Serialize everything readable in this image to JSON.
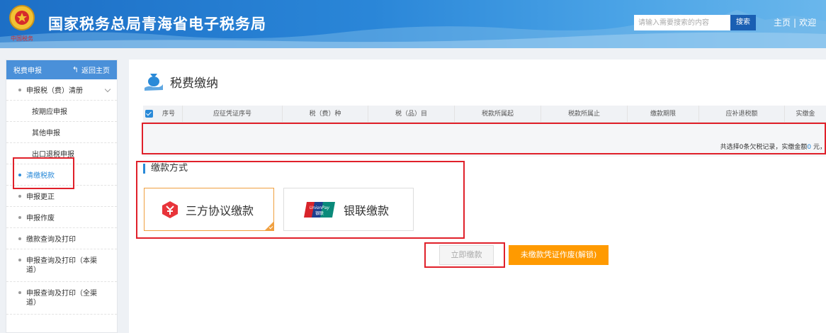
{
  "header": {
    "title": "国家税务总局青海省电子税务局",
    "search_placeholder": "请输入需要搜索的内容",
    "search_button": "搜索",
    "home_link": "主页",
    "separator": "|",
    "welcome": "欢迎",
    "emblem_icon": "national-tax-emblem-icon",
    "emblem_caption": "中国税务"
  },
  "sidebar": {
    "header_title": "税费申报",
    "back_label": "返回主页",
    "back_icon": "back-arrow-icon",
    "items": [
      {
        "label": "申报税（费）清册",
        "type": "group",
        "expandable": true
      },
      {
        "label": "按期应申报",
        "type": "sub"
      },
      {
        "label": "其他申报",
        "type": "sub"
      },
      {
        "label": "出口退税申报",
        "type": "sub"
      },
      {
        "label": "清缴税款",
        "type": "item",
        "active": true
      },
      {
        "label": "申报更正",
        "type": "item"
      },
      {
        "label": "申报作废",
        "type": "item"
      },
      {
        "label": "缴款查询及打印",
        "type": "item"
      },
      {
        "label": "申报查询及打印（本渠道）",
        "type": "item"
      },
      {
        "label": "申报查询及打印（全渠道）",
        "type": "item"
      }
    ]
  },
  "main": {
    "page_title": "税费缴纳",
    "page_icon": "money-bag-hand-icon",
    "table": {
      "columns": [
        "序号",
        "应征凭证序号",
        "税（费）种",
        "税（品）目",
        "税款所属起",
        "税款所属止",
        "缴款期限",
        "应补退税额",
        "实缴金"
      ],
      "select_all_checked": true,
      "rows": []
    },
    "summary": {
      "prefix": "共选择",
      "count": "0",
      "middle": "条欠税记录，实缴金额",
      "amount": "0",
      "suffix": " 元，"
    },
    "payment_section_label": "缴款方式",
    "payment_methods": [
      {
        "label": "三方协议缴款",
        "icon": "tripartite-agreement-icon",
        "selected": true
      },
      {
        "label": "银联缴款",
        "icon": "unionpay-icon",
        "logo_text": "UnionPay 银联",
        "selected": false
      }
    ],
    "pay_now_button": "立即缴款",
    "void_button": "未缴款凭证作废(解锁)"
  },
  "colors": {
    "header_blue": "#1d6fc6",
    "accent_blue": "#2a8ad8",
    "orange": "#ff9a00",
    "annotation_red": "#e0202a"
  }
}
